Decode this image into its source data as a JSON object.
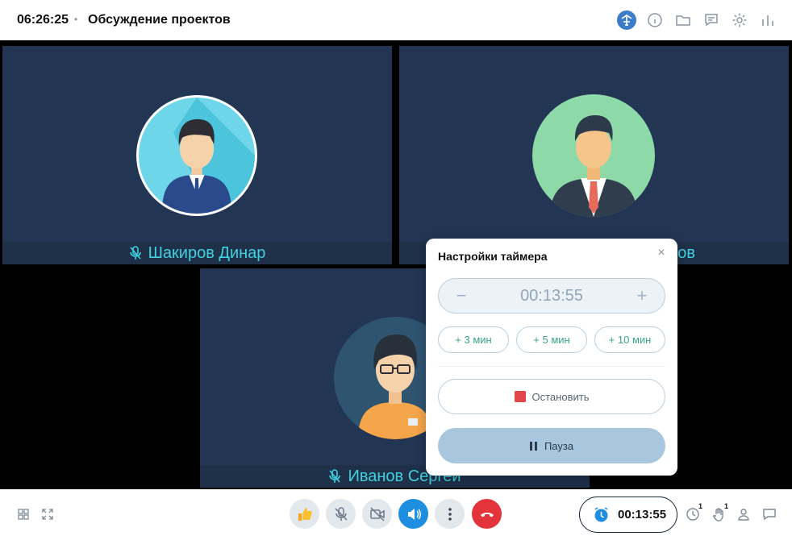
{
  "header": {
    "time": "06:26:25",
    "separator": "•",
    "title": "Обсуждение проектов",
    "icons": [
      "network-icon",
      "info-icon",
      "folder-icon",
      "chat-list-icon",
      "settings-icon",
      "stats-icon"
    ]
  },
  "participants": [
    {
      "name": "Шакиров Динар",
      "mic_icon": "mic-muted-icon",
      "avatar_bg": "#6fd6ea"
    },
    {
      "name": "ов",
      "mic_icon": "none",
      "avatar_bg": "#8ed9a8"
    },
    {
      "name": "Иванов Сергей",
      "mic_icon": "mic-muted-icon",
      "avatar_bg": "#2f5470"
    }
  ],
  "timer_popup": {
    "title": "Настройки таймера",
    "close": "×",
    "minus": "−",
    "value": "00:13:55",
    "plus": "+",
    "add_buttons": [
      "+ 3 мин",
      "+ 5 мин",
      "+ 10 мин"
    ],
    "stop_label": "Остановить",
    "pause_label": "Пауза"
  },
  "toolbar": {
    "timer_value": "00:13:55",
    "clock_badge": "1",
    "hand_badge": "1"
  },
  "colors": {
    "accent": "#3d7cc9",
    "tile_bg": "#223552",
    "name_text": "#3fd1df",
    "end_call": "#e4343b",
    "stop": "#e0464a",
    "pause_bg": "#a8c6de"
  }
}
